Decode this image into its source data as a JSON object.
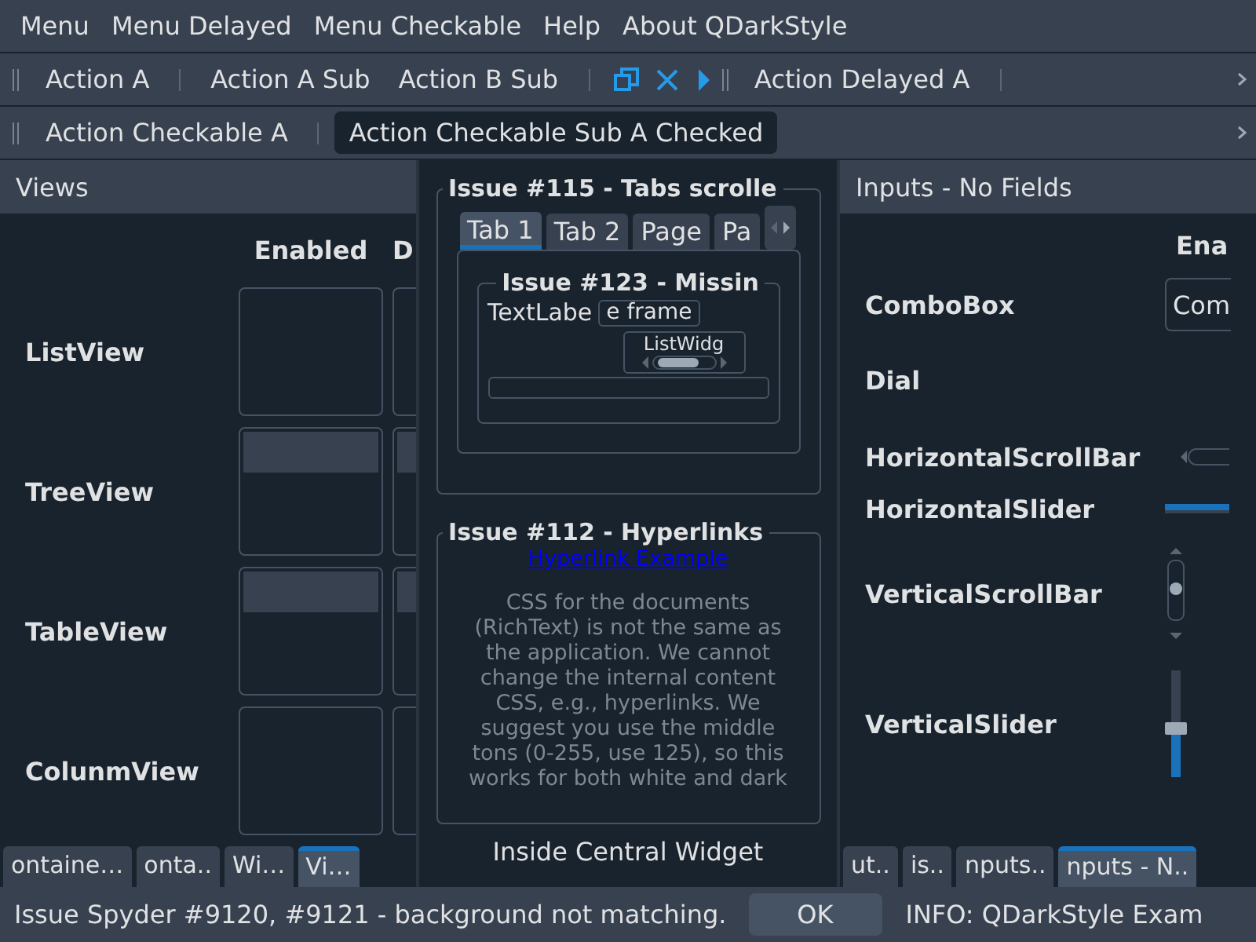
{
  "menu_bar": [
    "Menu",
    "Menu Delayed",
    "Menu Checkable",
    "Help",
    "About QDarkStyle"
  ],
  "toolbars": [
    {
      "items": [
        {
          "kind": "action",
          "label": "Action A"
        },
        {
          "kind": "separator"
        },
        {
          "kind": "action",
          "label": "Action A Sub"
        },
        {
          "kind": "action",
          "label": "Action B Sub"
        },
        {
          "kind": "separator"
        },
        {
          "kind": "icons"
        },
        {
          "kind": "handle"
        },
        {
          "kind": "action",
          "label": "Action Delayed A"
        },
        {
          "kind": "separator"
        }
      ]
    },
    {
      "items": [
        {
          "kind": "action",
          "label": "Action Checkable A",
          "checked": false
        },
        {
          "kind": "separator"
        },
        {
          "kind": "action",
          "label": "Action Checkable Sub A Checked",
          "checked": true
        }
      ]
    }
  ],
  "views_dock": {
    "title": "Views",
    "columns": [
      "Enabled",
      "D"
    ],
    "rows": [
      {
        "label": "ListView",
        "kind": "list"
      },
      {
        "label": "TreeView",
        "kind": "tree"
      },
      {
        "label": "TableView",
        "kind": "table"
      },
      {
        "label": "ColunmView",
        "kind": "column"
      }
    ],
    "tabs": [
      {
        "label": "ontaine…",
        "selected": false
      },
      {
        "label": "onta..",
        "selected": false
      },
      {
        "label": "Wi…",
        "selected": false
      },
      {
        "label": "Vi…",
        "selected": true
      }
    ]
  },
  "central": {
    "tabs_group": {
      "title": "Issue #115 - Tabs scrolle",
      "tabs": [
        {
          "label": "Tab 1",
          "selected": true
        },
        {
          "label": "Tab 2",
          "selected": false
        },
        {
          "label": "Page",
          "selected": false
        },
        {
          "label": "Pa",
          "selected": false
        }
      ],
      "inner_group": {
        "title": "Issue #123 - Missin",
        "label": "TextLabe",
        "field_value": "e frame",
        "list_text": "ListWidg"
      }
    },
    "hyperlink_group": {
      "title": "Issue #112 - Hyperlinks",
      "link": "Hyperlink Example",
      "text": "CSS for the documents (RichText) is not the same as the application. We cannot change the internal content CSS, e.g., hyperlinks. We suggest you use the middle tons (0-255, use 125), so this works for both white and dark"
    },
    "caption": "Inside Central Widget"
  },
  "inputs_dock": {
    "title": "Inputs - No Fields",
    "columns": [
      "Ena"
    ],
    "rows": [
      {
        "label": "ComboBox",
        "kind": "combo",
        "value": "Com"
      },
      {
        "label": "Dial",
        "kind": "dial"
      },
      {
        "label": "HorizontalScrollBar",
        "kind": "hscroll"
      },
      {
        "label": "HorizontalSlider",
        "kind": "hslider",
        "level": 1
      },
      {
        "label": "VerticalScrollBar",
        "kind": "vscroll"
      },
      {
        "label": "VerticalSlider",
        "kind": "vslider",
        "level": 0.45
      }
    ],
    "tabs": [
      {
        "label": "ut..",
        "selected": false
      },
      {
        "label": "is..",
        "selected": false
      },
      {
        "label": "nputs..",
        "selected": false
      },
      {
        "label": "nputs - N..",
        "selected": true
      }
    ]
  },
  "status_bar": {
    "message": "Issue Spyder #9120, #9121 - background not matching.",
    "button": "OK",
    "info": "INFO: QDarkStyle Exam"
  }
}
